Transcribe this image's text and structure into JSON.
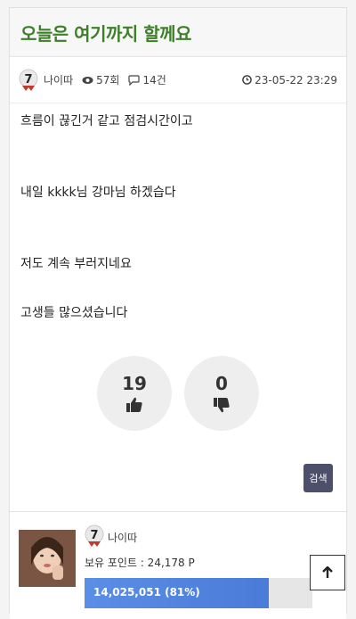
{
  "post": {
    "title": "오늘은 여기까지 할께요",
    "author": "나이따",
    "level": "7",
    "views": "57회",
    "comments": "14건",
    "datetime": "23-05-22 23:29",
    "lines": [
      "흐름이  끊긴거 같고 점검시간이고",
      "내일 kkkk님  강마님 하겠습다",
      "저도 계속 부러지네요",
      "고생들 많으셨습니다"
    ]
  },
  "votes": {
    "good": "19",
    "bad": "0"
  },
  "actions": {
    "search_label": "검색"
  },
  "author_box": {
    "name": "나이따",
    "level": "7",
    "points_label": "보유 포인트 : 24,178 P",
    "xp_label": "14,025,051 (81%)",
    "xp_fraction": 0.81
  },
  "colors": {
    "title": "#3e7f2a",
    "button": "#4d4f6b",
    "xp_bar": "#5b8ee6"
  },
  "icons": {
    "views": "eye-icon",
    "comments": "comment-icon",
    "date": "clock-icon",
    "top": "arrow-up-icon"
  }
}
